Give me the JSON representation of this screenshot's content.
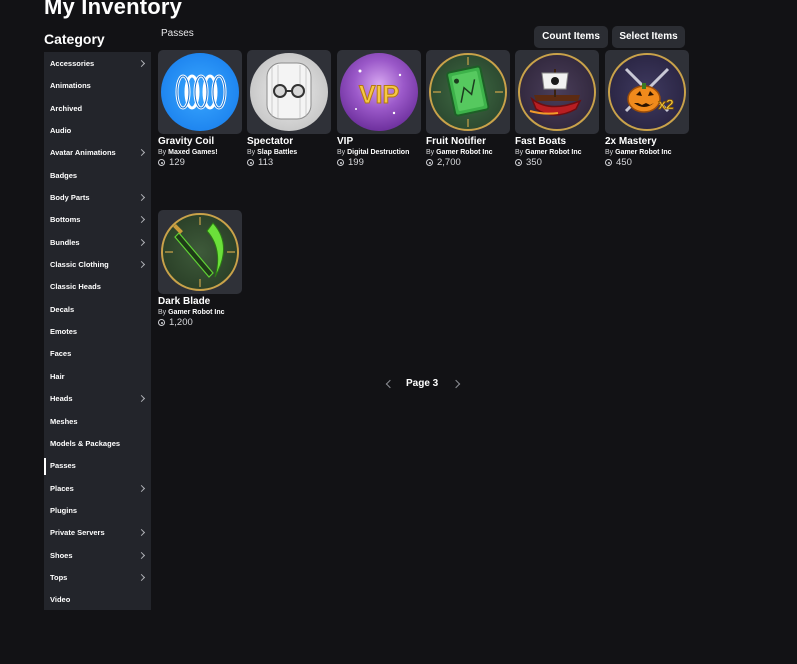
{
  "page_title": "My Inventory",
  "category_heading": "Category",
  "section_label": "Passes",
  "buttons": {
    "count_items": "Count Items",
    "select_items": "Select Items"
  },
  "sidebar": {
    "items": [
      {
        "label": "Accessories",
        "chevron": true
      },
      {
        "label": "Animations",
        "chevron": false
      },
      {
        "label": "Archived",
        "chevron": false
      },
      {
        "label": "Audio",
        "chevron": false
      },
      {
        "label": "Avatar Animations",
        "chevron": true
      },
      {
        "label": "Badges",
        "chevron": false
      },
      {
        "label": "Body Parts",
        "chevron": true
      },
      {
        "label": "Bottoms",
        "chevron": true
      },
      {
        "label": "Bundles",
        "chevron": true
      },
      {
        "label": "Classic Clothing",
        "chevron": true
      },
      {
        "label": "Classic Heads",
        "chevron": false
      },
      {
        "label": "Decals",
        "chevron": false
      },
      {
        "label": "Emotes",
        "chevron": false
      },
      {
        "label": "Faces",
        "chevron": false
      },
      {
        "label": "Hair",
        "chevron": false
      },
      {
        "label": "Heads",
        "chevron": true
      },
      {
        "label": "Meshes",
        "chevron": false
      },
      {
        "label": "Models & Packages",
        "chevron": false
      },
      {
        "label": "Passes",
        "chevron": false,
        "active": true
      },
      {
        "label": "Places",
        "chevron": true
      },
      {
        "label": "Plugins",
        "chevron": false
      },
      {
        "label": "Private Servers",
        "chevron": true
      },
      {
        "label": "Shoes",
        "chevron": true
      },
      {
        "label": "Tops",
        "chevron": true
      },
      {
        "label": "Video",
        "chevron": false
      }
    ]
  },
  "by_prefix": "By",
  "items": [
    {
      "name": "Gravity Coil",
      "creator": "Maxed Games!",
      "price": "129",
      "icon": "gravity-coil-icon"
    },
    {
      "name": "Spectator",
      "creator": "Slap Battles",
      "price": "113",
      "icon": "spectator-mask-icon"
    },
    {
      "name": "VIP",
      "creator": "Digital Destruction",
      "price": "199",
      "icon": "vip-icon"
    },
    {
      "name": "Fruit Notifier",
      "creator": "Gamer Robot Inc",
      "price": "2,700",
      "icon": "fruit-notifier-book-icon"
    },
    {
      "name": "Fast Boats",
      "creator": "Gamer Robot Inc",
      "price": "350",
      "icon": "fast-boat-icon"
    },
    {
      "name": "2x Mastery",
      "creator": "Gamer Robot Inc",
      "price": "450",
      "icon": "mastery-pumpkin-icon"
    },
    {
      "name": "Dark Blade",
      "creator": "Gamer Robot Inc",
      "price": "1,200",
      "icon": "dark-blade-icon"
    }
  ],
  "pager": {
    "label": "Page 3"
  },
  "colors": {
    "background": "#121215",
    "sidebar": "#23252b",
    "card": "#2f3138",
    "button": "#2b2d33"
  }
}
